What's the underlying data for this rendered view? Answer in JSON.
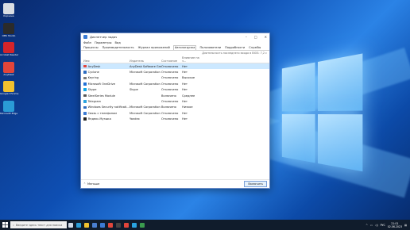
{
  "desktop": {
    "icons": [
      {
        "label": "Корзина",
        "color": "#d9dde3"
      },
      {
        "label": "OBS Studio",
        "color": "#2b2b2b"
      },
      {
        "label": "Acrobat Reader",
        "color": "#d4242a"
      },
      {
        "label": "AnyDesk",
        "color": "#e2453a"
      },
      {
        "label": "Google Chrome",
        "color": "#f2c12e"
      },
      {
        "label": "Microsoft Edge",
        "color": "#2a9bd6"
      }
    ]
  },
  "window": {
    "title": "Диспетчер задач",
    "menu": [
      "Файл",
      "Параметры",
      "Вид"
    ],
    "tabs": [
      "Процессы",
      "Производительность",
      "Журнал приложений",
      "Автозагрузка",
      "Пользователи",
      "Подробности",
      "Службы"
    ],
    "active_tab_index": 3,
    "boot_info": "Длительность последнего входа в BIOS: 7,2 с",
    "columns": {
      "name": "Имя",
      "publisher": "Издатель",
      "status": "Состояние",
      "impact": "Влияние на з..."
    },
    "rows": [
      {
        "name": "AnyDesk",
        "publisher": "AnyDesk Software GmbH",
        "status": "Отключено",
        "impact": "Нет",
        "icon_color": "#e2453a",
        "selected": true
      },
      {
        "name": "Cyclone",
        "publisher": "Microsoft Corporation",
        "status": "Отключено",
        "impact": "Нет",
        "icon_color": "#2d6cc0"
      },
      {
        "name": "Keyring",
        "publisher": "",
        "status": "Отключено",
        "impact": "Высокое",
        "icon_color": "#7a7a7a"
      },
      {
        "name": "Microsoft OneDrive",
        "publisher": "Microsoft Corporation",
        "status": "Отключено",
        "impact": "Нет",
        "icon_color": "#1e6fd6"
      },
      {
        "name": "Skype",
        "publisher": "Skype",
        "status": "Отключено",
        "impact": "Нет",
        "icon_color": "#12a6e6"
      },
      {
        "name": "SteelSeries Module",
        "publisher": "",
        "status": "Включено",
        "impact": "Среднее",
        "icon_color": "#555555"
      },
      {
        "name": "Telegram",
        "publisher": "",
        "status": "Отключено",
        "impact": "Нет",
        "icon_color": "#2aa3df"
      },
      {
        "name": "Windows Security notificati...",
        "publisher": "Microsoft Corporation",
        "status": "Включено",
        "impact": "Низкое",
        "icon_color": "#2d6cc0"
      },
      {
        "name": "Связь с телефоном",
        "publisher": "Microsoft Corporation",
        "status": "Отключено",
        "impact": "Нет",
        "icon_color": "#3b7bd4"
      },
      {
        "name": "Яндекс.Музыка",
        "publisher": "Yandex",
        "status": "Отключено",
        "impact": "Нет",
        "icon_color": "#222222"
      }
    ],
    "footer": {
      "less_label": "Меньше",
      "button_label": "Включить"
    }
  },
  "taskbar": {
    "search_placeholder": "Введите здесь текст для поиска",
    "apps": [
      {
        "name": "task-view",
        "color": "#cfd8e6"
      },
      {
        "name": "edge",
        "color": "#2a9bd6"
      },
      {
        "name": "explorer",
        "color": "#f2c12e"
      },
      {
        "name": "store",
        "color": "#4a7fd0"
      },
      {
        "name": "mail",
        "color": "#3b7bd4"
      },
      {
        "name": "chrome",
        "color": "#e0473c"
      },
      {
        "name": "obs",
        "color": "#444"
      },
      {
        "name": "anydesk",
        "color": "#e2453a"
      },
      {
        "name": "telegram",
        "color": "#2aa3df"
      },
      {
        "name": "task-manager",
        "color": "#3a9b4e"
      }
    ],
    "tray": {
      "lang": "РУС",
      "time": "21:01",
      "date": "02.06.2023"
    }
  }
}
